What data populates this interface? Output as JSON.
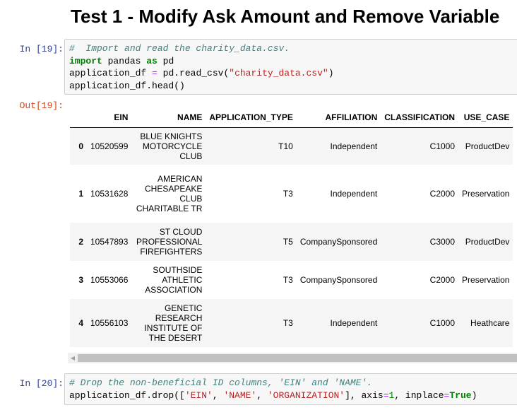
{
  "page": {
    "title": "Test 1 - Modify Ask Amount and Remove Variable"
  },
  "cells": {
    "in19": {
      "prompt": "In [19]:",
      "lines": [
        [
          {
            "t": "comment",
            "v": "#  Import and read the charity_data.csv."
          }
        ],
        [
          {
            "t": "keyword",
            "v": "import"
          },
          {
            "t": "plain",
            "v": " pandas "
          },
          {
            "t": "keyword",
            "v": "as"
          },
          {
            "t": "plain",
            "v": " pd"
          }
        ],
        [
          {
            "t": "plain",
            "v": "application_df "
          },
          {
            "t": "operator",
            "v": "="
          },
          {
            "t": "plain",
            "v": " pd.read_csv("
          },
          {
            "t": "string",
            "v": "\"charity_data.csv\""
          },
          {
            "t": "plain",
            "v": ")"
          }
        ],
        [
          {
            "t": "plain",
            "v": "application_df.head()"
          }
        ]
      ]
    },
    "out19": {
      "prompt": "Out[19]:"
    },
    "in20": {
      "prompt": "In [20]:",
      "lines": [
        [
          {
            "t": "comment",
            "v": "# Drop the non-beneficial ID columns, 'EIN' and 'NAME'."
          }
        ],
        [
          {
            "t": "plain",
            "v": "application_df.drop(["
          },
          {
            "t": "string",
            "v": "'EIN'"
          },
          {
            "t": "plain",
            "v": ", "
          },
          {
            "t": "string",
            "v": "'NAME'"
          },
          {
            "t": "plain",
            "v": ", "
          },
          {
            "t": "string",
            "v": "'ORGANIZATION'"
          },
          {
            "t": "plain",
            "v": "], axis"
          },
          {
            "t": "operator",
            "v": "="
          },
          {
            "t": "number",
            "v": "1"
          },
          {
            "t": "plain",
            "v": ", inplace"
          },
          {
            "t": "operator",
            "v": "="
          },
          {
            "t": "keyword",
            "v": "True"
          },
          {
            "t": "plain",
            "v": ")"
          }
        ]
      ]
    }
  },
  "dataframe": {
    "columns": [
      "",
      "EIN",
      "NAME",
      "APPLICATION_TYPE",
      "AFFILIATION",
      "CLASSIFICATION",
      "USE_CASE"
    ],
    "rows": [
      {
        "index": "0",
        "ein": "10520599",
        "name": "BLUE KNIGHTS MOTORCYCLE CLUB",
        "app_type": "T10",
        "affiliation": "Independent",
        "classification": "C1000",
        "use_case": "ProductDev"
      },
      {
        "index": "1",
        "ein": "10531628",
        "name": "AMERICAN CHESAPEAKE CLUB CHARITABLE TR",
        "app_type": "T3",
        "affiliation": "Independent",
        "classification": "C2000",
        "use_case": "Preservation"
      },
      {
        "index": "2",
        "ein": "10547893",
        "name": "ST CLOUD PROFESSIONAL FIREFIGHTERS",
        "app_type": "T5",
        "affiliation": "CompanySponsored",
        "classification": "C3000",
        "use_case": "ProductDev"
      },
      {
        "index": "3",
        "ein": "10553066",
        "name": "SOUTHSIDE ATHLETIC ASSOCIATION",
        "app_type": "T3",
        "affiliation": "CompanySponsored",
        "classification": "C2000",
        "use_case": "Preservation"
      },
      {
        "index": "4",
        "ein": "10556103",
        "name": "GENETIC RESEARCH INSTITUTE OF THE DESERT",
        "app_type": "T3",
        "affiliation": "Independent",
        "classification": "C1000",
        "use_case": "Heathcare"
      }
    ]
  },
  "scrollbar": {
    "left_arrow_icon": "scroll-left-arrow-icon"
  }
}
